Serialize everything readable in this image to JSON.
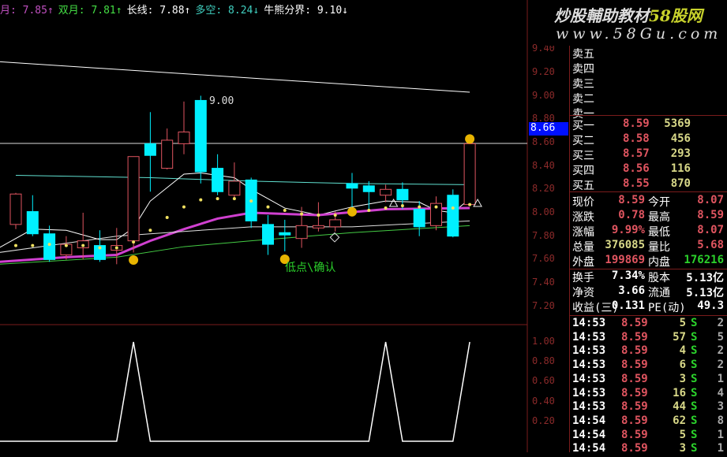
{
  "indicators": [
    {
      "label": "月: 7.85↑",
      "color": "#c050c0"
    },
    {
      "label": "双月: 7.81↑",
      "color": "#44dd44"
    },
    {
      "label": "长线: 7.88↑",
      "color": "#ffffff"
    },
    {
      "label": "多空: 8.24↓",
      "color": "#40d0c0"
    },
    {
      "label": "牛熊分界: 9.10↓",
      "color": "#ffffff"
    }
  ],
  "chart_annotations": {
    "high_label": "9.00",
    "low_label": "低点\\确认"
  },
  "current_price_tag": "8.66",
  "price_axis": [
    "9.40",
    "9.20",
    "9.00",
    "8.80",
    "8.60",
    "8.40",
    "8.20",
    "8.00",
    "7.80",
    "7.60",
    "7.40",
    "7.20"
  ],
  "indicator_axis": [
    "1.00",
    "0.80",
    "0.60",
    "0.40",
    "0.20"
  ],
  "logo": {
    "line1": "炒股輔助教材",
    "line1_brand": "58股网",
    "line2": "www.58Gu.com"
  },
  "order_book": {
    "asks": [
      {
        "label": "卖五"
      },
      {
        "label": "卖四"
      },
      {
        "label": "卖三"
      },
      {
        "label": "卖二"
      },
      {
        "label": "卖一"
      }
    ],
    "bids": [
      {
        "label": "买一",
        "price": "8.59",
        "vol": "5369"
      },
      {
        "label": "买二",
        "price": "8.58",
        "vol": "456"
      },
      {
        "label": "买三",
        "price": "8.57",
        "vol": "293"
      },
      {
        "label": "买四",
        "price": "8.56",
        "vol": "116"
      },
      {
        "label": "买五",
        "price": "8.55",
        "vol": "870"
      }
    ]
  },
  "quote": [
    {
      "l1": "现价",
      "v1": "8.59",
      "c1": "r",
      "l2": "今开",
      "v2": "8.07",
      "c2": "r"
    },
    {
      "l1": "涨跌",
      "v1": "0.78",
      "c1": "r",
      "l2": "最高",
      "v2": "8.59",
      "c2": "r"
    },
    {
      "l1": "涨幅",
      "v1": "9.99%",
      "c1": "r",
      "l2": "最低",
      "v2": "8.07",
      "c2": "r"
    },
    {
      "l1": "总量",
      "v1": "376085",
      "c1": "y",
      "l2": "量比",
      "v2": "5.68",
      "c2": "r"
    },
    {
      "l1": "外盘",
      "v1": "199869",
      "c1": "r",
      "l2": "内盘",
      "v2": "176216",
      "c2": "g"
    }
  ],
  "fundamentals": [
    {
      "l1": "换手",
      "v1": "7.34%",
      "l2": "股本",
      "v2": "5.13亿"
    },
    {
      "l1": "净资",
      "v1": "3.66",
      "l2": "流通",
      "v2": "5.13亿"
    },
    {
      "l1": "收益(三)",
      "v1": "0.131",
      "l2": "PE(动)",
      "v2": "49.3"
    }
  ],
  "ticks": [
    {
      "t": "14:53",
      "p": "8.59",
      "v": "5",
      "s": "S",
      "n": "2"
    },
    {
      "t": "14:53",
      "p": "8.59",
      "v": "57",
      "s": "S",
      "n": "5"
    },
    {
      "t": "14:53",
      "p": "8.59",
      "v": "4",
      "s": "S",
      "n": "2"
    },
    {
      "t": "14:53",
      "p": "8.59",
      "v": "6",
      "s": "S",
      "n": "2"
    },
    {
      "t": "14:53",
      "p": "8.59",
      "v": "3",
      "s": "S",
      "n": "1"
    },
    {
      "t": "14:53",
      "p": "8.59",
      "v": "16",
      "s": "S",
      "n": "4"
    },
    {
      "t": "14:53",
      "p": "8.59",
      "v": "44",
      "s": "S",
      "n": "3"
    },
    {
      "t": "14:54",
      "p": "8.59",
      "v": "62",
      "s": "S",
      "n": "8"
    },
    {
      "t": "14:54",
      "p": "8.59",
      "v": "5",
      "s": "S",
      "n": "1"
    },
    {
      "t": "14:54",
      "p": "8.59",
      "v": "3",
      "s": "S",
      "n": "1"
    }
  ],
  "chart_data": {
    "type": "candlestick",
    "ylim": [
      7.1,
      9.5
    ],
    "candles": [
      [
        7.9,
        8.16,
        8.17,
        7.86
      ],
      [
        8.01,
        7.82,
        8.15,
        7.8
      ],
      [
        7.82,
        7.6,
        7.89,
        7.58
      ],
      [
        7.64,
        7.73,
        7.8,
        7.6
      ],
      [
        7.7,
        7.76,
        8.0,
        7.6
      ],
      [
        7.72,
        7.6,
        7.85,
        7.58
      ],
      [
        7.68,
        7.72,
        7.87,
        7.56
      ],
      [
        7.76,
        8.48,
        8.48,
        7.66
      ],
      [
        8.59,
        8.49,
        8.86,
        8.18
      ],
      [
        8.38,
        8.62,
        8.72,
        8.37
      ],
      [
        8.59,
        8.69,
        8.95,
        8.5
      ],
      [
        8.96,
        8.35,
        9.0,
        8.25
      ],
      [
        8.38,
        8.18,
        8.5,
        8.15
      ],
      [
        8.15,
        8.27,
        8.43,
        8.13
      ],
      [
        8.28,
        7.93,
        8.3,
        7.87
      ],
      [
        7.9,
        7.73,
        7.98,
        7.64
      ],
      [
        7.83,
        7.81,
        7.94,
        7.67
      ],
      [
        7.78,
        7.89,
        8.05,
        7.7
      ],
      [
        7.87,
        7.89,
        8.09,
        7.84
      ],
      [
        7.88,
        7.94,
        8.01,
        7.84
      ],
      [
        8.25,
        8.21,
        8.34,
        8.03
      ],
      [
        8.23,
        8.18,
        8.27,
        8.02
      ],
      [
        8.15,
        8.2,
        8.24,
        8.09
      ],
      [
        8.2,
        8.11,
        8.26,
        8.03
      ],
      [
        8.03,
        7.88,
        8.1,
        7.8
      ],
      [
        7.89,
        8.08,
        8.14,
        7.85
      ],
      [
        8.15,
        7.8,
        8.2,
        7.79
      ],
      [
        8.07,
        8.59,
        8.59,
        8.07
      ]
    ],
    "lines": [
      {
        "name": "牛熊分界",
        "color": "#ffffff",
        "width": 1,
        "x": [
          0,
          27
        ],
        "values": [
          9.29,
          9.03
        ],
        "x_offset": -20
      },
      {
        "name": "多空",
        "color": "#60e0d0",
        "width": 1,
        "x": [
          0,
          8,
          14,
          20,
          27
        ],
        "values": [
          8.32,
          8.3,
          8.27,
          8.25,
          8.24
        ]
      },
      {
        "name": "长线",
        "color": "#ffffff",
        "width": 1,
        "x": [
          -1,
          1,
          3,
          5,
          6,
          7,
          8,
          10,
          11,
          13,
          14,
          16,
          18,
          20,
          22,
          24,
          25,
          26,
          27
        ],
        "values": [
          7.7,
          7.86,
          7.85,
          7.77,
          7.77,
          7.87,
          8.1,
          8.33,
          8.34,
          8.3,
          8.2,
          8.04,
          7.98,
          8.05,
          8.1,
          8.09,
          8.02,
          8.0,
          8.12
        ]
      },
      {
        "name": "月",
        "color": "#d040d0",
        "width": 3,
        "x": [
          -1,
          3,
          6,
          8,
          10,
          12,
          14,
          18,
          22,
          27
        ],
        "values": [
          7.58,
          7.62,
          7.64,
          7.76,
          7.86,
          7.95,
          8.0,
          7.98,
          8.03,
          8.04
        ]
      },
      {
        "name": "长线2",
        "color": "#e0e0e0",
        "width": 1,
        "x": [
          -1,
          6,
          10,
          14,
          20,
          27
        ],
        "values": [
          7.66,
          7.8,
          7.84,
          7.88,
          7.88,
          7.93
        ]
      },
      {
        "name": "双月",
        "color": "#44cc44",
        "width": 1,
        "x": [
          -1,
          6,
          10,
          14,
          20,
          27
        ],
        "values": [
          7.56,
          7.62,
          7.71,
          7.76,
          7.83,
          7.89
        ]
      }
    ],
    "dots": [
      7.72,
      7.72,
      7.73,
      7.72,
      7.72,
      7.7,
      7.7,
      7.75,
      7.85,
      7.96,
      8.05,
      8.11,
      8.12,
      8.12,
      8.1,
      8.05,
      8.02,
      7.99,
      7.98,
      7.98,
      8.0,
      8.02,
      8.04,
      8.06,
      8.05,
      8.05,
      8.04,
      8.07
    ],
    "signals": {
      "smiley_at": [
        7,
        16,
        20,
        27
      ],
      "diamond_at": [
        19
      ],
      "triangle_at": [
        22,
        27
      ]
    },
    "indicator": {
      "ylim": [
        0,
        1.2
      ],
      "x": [
        -1,
        6,
        7,
        8,
        21,
        22,
        23,
        26,
        27
      ],
      "values": [
        0,
        0,
        1,
        0,
        0,
        1,
        0,
        0,
        1
      ]
    }
  }
}
